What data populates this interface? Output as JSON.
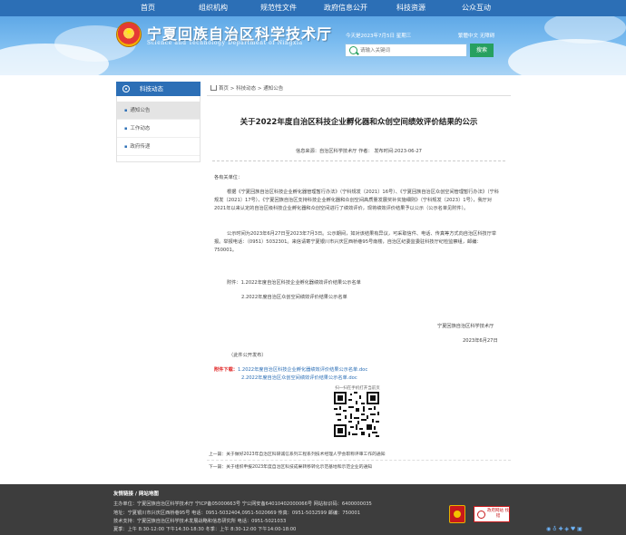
{
  "nav": {
    "items": [
      "首页",
      "组织机构",
      "规范性文件",
      "政府信息公开",
      "科技资源",
      "公众互动"
    ]
  },
  "header": {
    "site_title": "宁夏回族自治区科学技术厅",
    "site_subtitle": "Science and Technology Department of Ningxia",
    "date_text": "今天是2023年7月5日 星期三",
    "util_text": "繁體中文  无障碍",
    "search_placeholder": "请输入关键词",
    "search_button": "搜索"
  },
  "sidebar": {
    "title": "科技动态",
    "items": [
      "通知公告",
      "工作动态",
      "政府传递"
    ]
  },
  "breadcrumb": "首页 > 科技动态 > 通知公告",
  "article": {
    "title": "关于2022年度自治区科技企业孵化器和众创空间绩效评价结果的公示",
    "meta": "信息来源：自治区科学技术厅  作者：   发布时间:2023-06-27",
    "salutation": "各有关单位：",
    "para1": "根据《宁夏回族自治区科技企业孵化器管理暂行办法》（宁科规发〔2021〕16号）、《宁夏回族自治区众创空间管理暂行办法》（宁科规发〔2021〕17号）、《宁夏回族自治区支持科技企业孵化器和众创空间高质量发展奖补实施细则》（宁科规发〔2023〕1号），我厅对2021年以来认定的自治区级科技企业孵化器和众创空间进行了绩效评价，现将绩效评价结果予以公示（公示名单见附件）。",
    "para2": "公示时间为2023年6月27日至2023年7月3日。公示期间，如对该结果有异议，可采取信件、电话、传真等方式向自治区科技厅举报。举报电话：（0951）5032301。来信请寄宁夏银川市兴庆区西桥巷95号南楼，自治区纪委监委驻科技厅纪检监察组，邮编：750001。",
    "attach_label": "附件：",
    "attach1": "1.2022年度自治区科技企业孵化器绩效评价结果公示名单",
    "attach2": "2.2022年度自治区众创空间绩效评价结果公示名单",
    "sign_org": "宁夏回族自治区科学技术厅",
    "sign_date": "2023年6月27日",
    "public_note": "（此件公开发布）",
    "download_label": "附件下载：",
    "download1": "1.2022年度自治区科技企业孵化器绩效评价结果公示名单.doc",
    "download2": "2.2022年度自治区众创空间绩效评价结果公示名单.doc",
    "qr_caption": "扫一扫在手机打开当前页",
    "prev": "上一篇：关于做好2023年自治区科研诚信系列工程系列技术经理人学会职称评审工作的通知",
    "next": "下一篇：关于组织申报2023年度自治区科技成果转移转化示范基地和示范企业的通知"
  },
  "footer": {
    "heading": "友情链接 / 网站地图",
    "line1": "主办单位：宁夏回族自治区科学技术厅  宁ICP备05000663号     宁公网安备64010402000066号   网站标识码：6400000035",
    "line2": "地址：宁夏银川市兴庆区西桥巷95号 电话：0951-5032404,0951-5020669  传真：0951-5032599  邮编：750001",
    "line3": "技术支持：宁夏回族自治区科学技术发展战略和信息研究所  电话：0951-5021033",
    "line4": "夏季：上午 8:30-12:00 下午14:30-18:30 冬季：上午 8:30-12:00 下午14:00-18:00",
    "badge_text": "政府网站 找错"
  }
}
